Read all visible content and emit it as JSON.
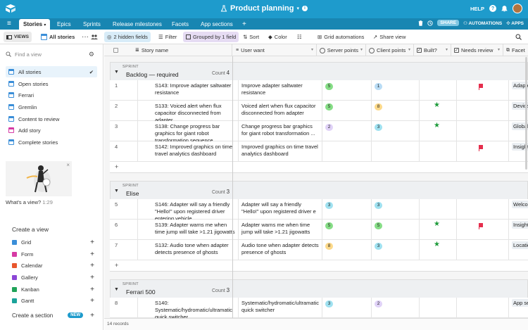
{
  "topbar": {
    "title": "Product planning",
    "help": "HELP",
    "help_icon": "?",
    "bg": "#1E9BCC"
  },
  "tabs": {
    "items": [
      {
        "label": "Stories"
      },
      {
        "label": "Epics"
      },
      {
        "label": "Sprints"
      },
      {
        "label": "Release milestones"
      },
      {
        "label": "Facets"
      },
      {
        "label": "App sections"
      }
    ],
    "add": "+",
    "share": "SHARE",
    "automations": "AUTOMATIONS",
    "apps": "APPS"
  },
  "viewbar": {
    "views": "VIEWS",
    "current_view": "All stories",
    "hidden_fields": "2 hidden fields",
    "filter": "Filter",
    "grouped": "Grouped by 1 field",
    "sort": "Sort",
    "color": "Color",
    "grid_automations": "Grid automations",
    "share_view": "Share view"
  },
  "sidebar": {
    "find_placeholder": "Find a view",
    "views": [
      {
        "label": "All stories",
        "type": "grid"
      },
      {
        "label": "Open stories",
        "type": "grid"
      },
      {
        "label": "Ferrari",
        "type": "grid"
      },
      {
        "label": "Gremlin",
        "type": "grid"
      },
      {
        "label": "Content to review",
        "type": "grid"
      },
      {
        "label": "Add story",
        "type": "form"
      },
      {
        "label": "Complete stories",
        "type": "grid"
      }
    ],
    "promo_caption": "What's a view?",
    "promo_duration": "1:29",
    "create_view_title": "Create a view",
    "create_items": [
      {
        "label": "Grid",
        "color": "#3a8ed8"
      },
      {
        "label": "Form",
        "color": "#d63aa4"
      },
      {
        "label": "Calendar",
        "color": "#e8562d"
      },
      {
        "label": "Gallery",
        "color": "#8b46d6"
      },
      {
        "label": "Kanban",
        "color": "#20a35a"
      },
      {
        "label": "Gantt",
        "color": "#1aa39a"
      }
    ],
    "create_section": "Create a section",
    "new_badge": "NEW"
  },
  "grid": {
    "columns": [
      "Story name",
      "User want",
      "Server points",
      "Client points",
      "Built?",
      "Needs review",
      "Facet"
    ],
    "group_caption": "SPRINT",
    "count_label": "Count",
    "groups": [
      {
        "name": "Backlog — required",
        "count": "4",
        "rows": [
          {
            "num": "1",
            "story": "S143: Improve adapter saltwater resistance",
            "want": "Improve adapter saltwater resistance",
            "server": "5",
            "client": "1",
            "built": false,
            "review": true,
            "facet": "Adapter"
          },
          {
            "num": "2",
            "story": "S133: Voiced alert when flux capacitor disconnected from adapter",
            "want": "Voiced alert when flux capacitor disconnected from adapter",
            "server": "5",
            "client": "8",
            "built": true,
            "review": false,
            "facet": "Device co"
          },
          {
            "num": "3",
            "story": "S138: Change progress bar graphics for giant robot transformation sequence",
            "want": "Change progress bar graphics for giant robot transformation ...",
            "server": "2",
            "client": "3",
            "built": true,
            "review": false,
            "facet": "Global"
          },
          {
            "num": "4",
            "story": "S142: Improved graphics on time travel analytics dashboard",
            "want": "Improved graphics on time travel analytics dashboard",
            "server": "",
            "client": "",
            "built": false,
            "review": true,
            "facet": "Insight: d"
          }
        ]
      },
      {
        "name": "Elise",
        "count": "3",
        "rows": [
          {
            "num": "5",
            "story": "S146: Adapter will say a friendly \"Hello!\" upon registered driver entering vehicle",
            "want": "Adapter will say a friendly \"Hello!\" upon registered driver e ...",
            "server": "3",
            "client": "3",
            "built": false,
            "review": false,
            "facet": "Welcome"
          },
          {
            "num": "6",
            "story": "S139: Adapter warns me when time jump will take >1.21 jigowatts",
            "want": "Adapter warns me when time jump will take >1.21 jigowatts",
            "server": "5",
            "client": "5",
            "built": true,
            "review": true,
            "facet": "Insight: fu"
          },
          {
            "num": "7",
            "story": "S132: Audio tone when adapter detects presence of ghosts",
            "want": "Audio tone when adapter detects presence of ghosts",
            "server": "8",
            "client": "3",
            "built": true,
            "review": false,
            "facet": "Location:"
          }
        ]
      },
      {
        "name": "Ferrari 500",
        "count": "3",
        "rows": [
          {
            "num": "8",
            "story": "S140: Systematic/hydromatic/ultramatic quick switcher",
            "want": "Systematic/hydromatic/ultramatic quick switcher",
            "server": "3",
            "client": "2",
            "built": false,
            "review": false,
            "facet": "App settin"
          }
        ]
      }
    ],
    "records": "14 records"
  },
  "pill_colors": {
    "1": "#b9dcf5",
    "2": "#e0d2f7",
    "3": "#9fe1f0",
    "5": "#86dd86",
    "8": "#fcd98a"
  }
}
